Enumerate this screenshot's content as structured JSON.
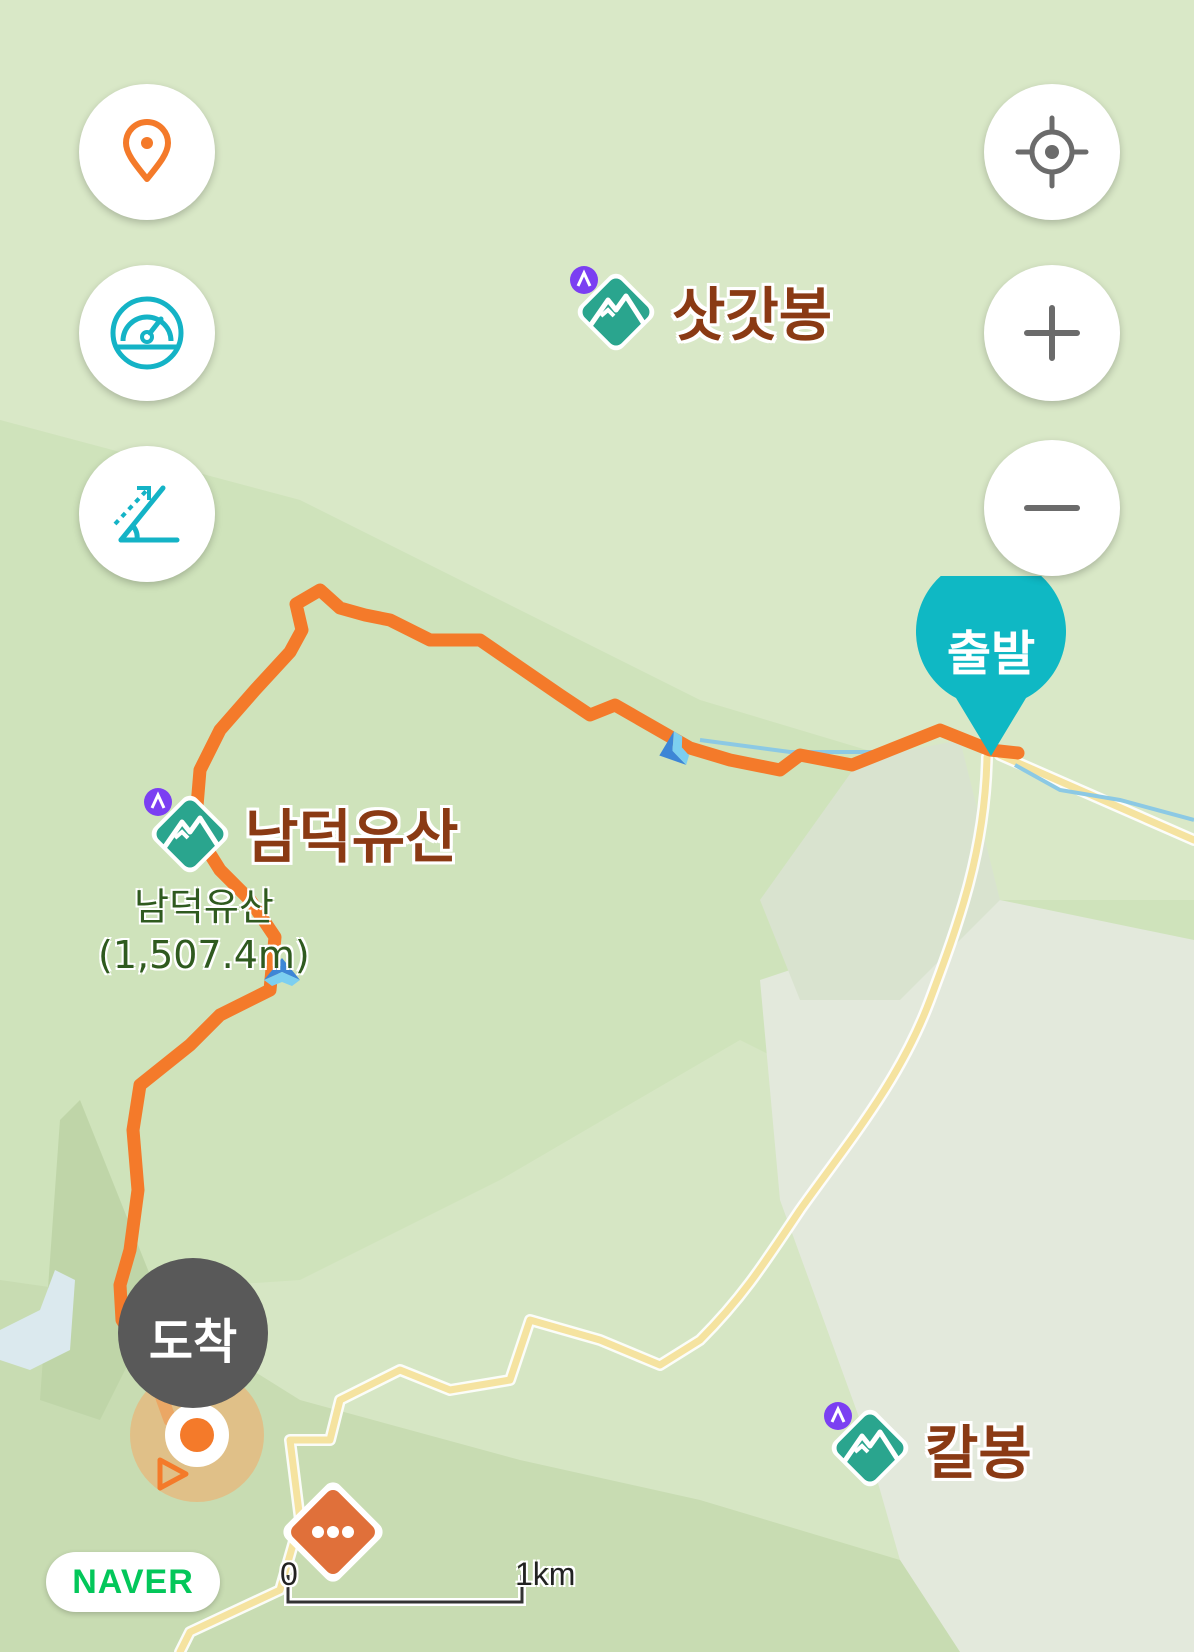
{
  "map": {
    "peaks": [
      {
        "id": "satgatbong",
        "label": "삿갓봉"
      },
      {
        "id": "namdeogyusan",
        "label": "남덕유산"
      },
      {
        "id": "kalbong",
        "label": "칼봉"
      }
    ],
    "summit_marker": {
      "name": "남덕유산",
      "elevation": "(1,507.4m)"
    },
    "route": {
      "start_label": "출발",
      "end_label": "도착"
    },
    "scale": {
      "start": "0",
      "end": "1km"
    },
    "logo": "NAVER"
  },
  "colors": {
    "route": "#f47a2a",
    "trail": "#f5e3a0",
    "start_pin": "#0fb8c4",
    "end_pin": "#595959",
    "peak_icon": "#2aa58e",
    "peak_label": "#8a3a14",
    "naver_green": "#03c75a"
  },
  "controls": {
    "left": [
      {
        "icon": "location-pin-icon"
      },
      {
        "icon": "speedometer-icon"
      },
      {
        "icon": "slope-angle-icon"
      }
    ],
    "right": [
      {
        "icon": "crosshair-icon"
      },
      {
        "icon": "plus-icon"
      },
      {
        "icon": "minus-icon"
      }
    ]
  }
}
